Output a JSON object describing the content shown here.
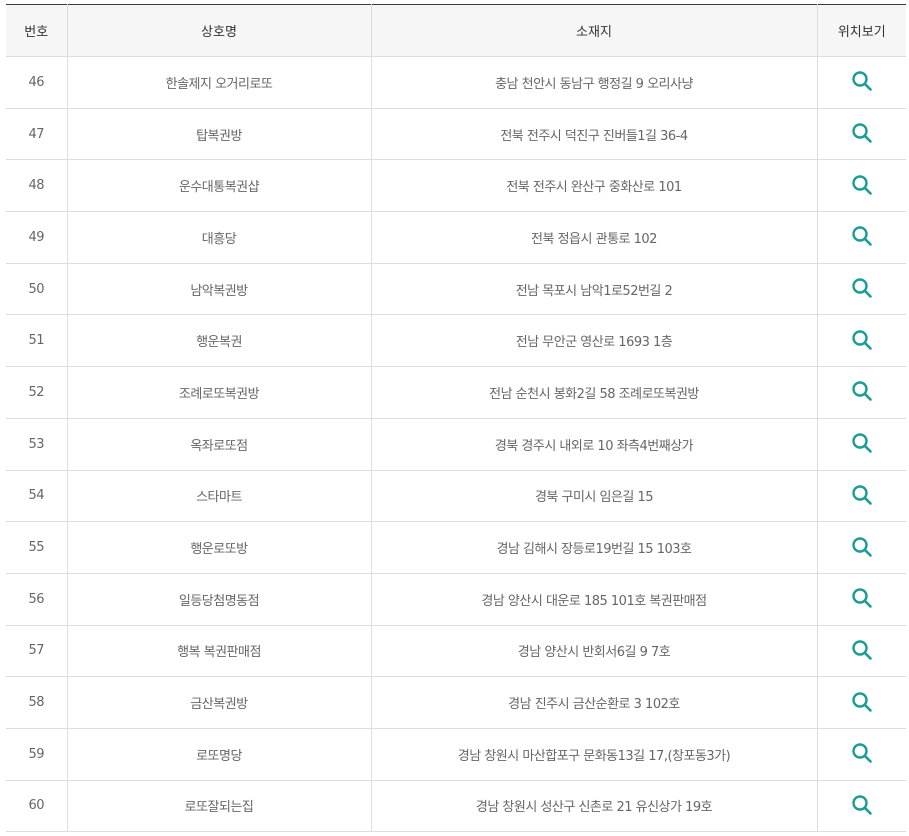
{
  "table": {
    "headers": {
      "number": "번호",
      "name": "상호명",
      "address": "소재지",
      "location": "위치보기"
    },
    "rows": [
      {
        "number": "46",
        "name": "한솔제지 오거리로또",
        "address": "충남 천안시 동남구 행정길 9 오리사냥"
      },
      {
        "number": "47",
        "name": "탑복권방",
        "address": "전북 전주시 덕진구 진버들1길 36-4"
      },
      {
        "number": "48",
        "name": "운수대통복권샵",
        "address": "전북 전주시 완산구 중화산로 101"
      },
      {
        "number": "49",
        "name": "대흥당",
        "address": "전북 정읍시 관통로 102"
      },
      {
        "number": "50",
        "name": "남악복권방",
        "address": "전남 목포시 남악1로52번길 2"
      },
      {
        "number": "51",
        "name": "행운복권",
        "address": "전남 무안군 영산로 1693 1층"
      },
      {
        "number": "52",
        "name": "조례로또복권방",
        "address": "전남 순천시 봉화2길 58 조례로또복권방"
      },
      {
        "number": "53",
        "name": "옥좌로또점",
        "address": "경북 경주시 내외로 10 좌측4번째상가"
      },
      {
        "number": "54",
        "name": "스타마트",
        "address": "경북 구미시 임은길 15"
      },
      {
        "number": "55",
        "name": "행운로또방",
        "address": "경남 김해시 장등로19번길 15 103호"
      },
      {
        "number": "56",
        "name": "일등당첨명동점",
        "address": "경남 양산시 대운로 185 101호 복권판매점"
      },
      {
        "number": "57",
        "name": "행복 복권판매점",
        "address": "경남 양산시 반회서6길 9 7호"
      },
      {
        "number": "58",
        "name": "금산복권방",
        "address": "경남 진주시 금산순환로 3 102호"
      },
      {
        "number": "59",
        "name": "로또명당",
        "address": "경남 창원시 마산합포구 문화동13길 17,(창포동3가)"
      },
      {
        "number": "60",
        "name": "로또잘되는집",
        "address": "경남 창원시 성산구 신촌로 21 유신상가 19호"
      }
    ]
  },
  "icons": {
    "location": "search-icon"
  },
  "colors": {
    "icon_accent": "#1a9d94",
    "header_bg": "#f6f6f6",
    "text": "#666666",
    "border": "#dcdcdc"
  }
}
